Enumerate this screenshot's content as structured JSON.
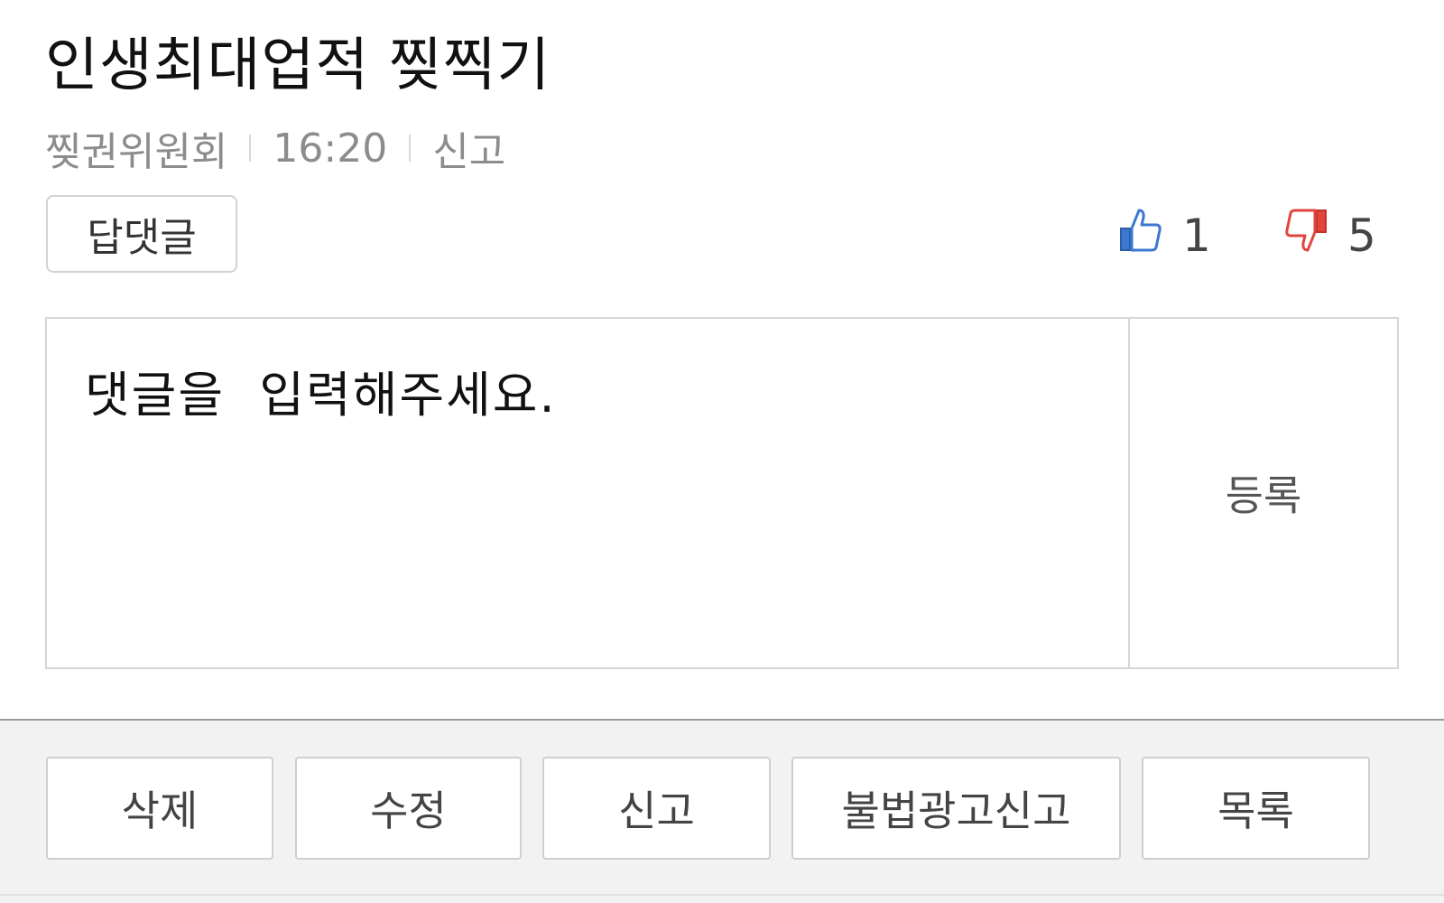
{
  "post": {
    "title": "인생최대업적 찢찍기",
    "author": "찢권위원회",
    "time": "16:20",
    "report_label": "신고"
  },
  "reply_label": "답댓글",
  "votes": {
    "up_count": "1",
    "down_count": "5",
    "up_icon": "thumbs-up-icon",
    "down_icon": "thumbs-down-icon",
    "up_color": "#3b78d0",
    "down_color": "#e0443c"
  },
  "comment": {
    "placeholder": "댓글을  입력해주세요.",
    "value": "",
    "submit_label": "등록"
  },
  "actions": {
    "delete": "삭제",
    "edit": "수정",
    "report": "신고",
    "report_ad": "불법광고신고",
    "list": "목록"
  }
}
